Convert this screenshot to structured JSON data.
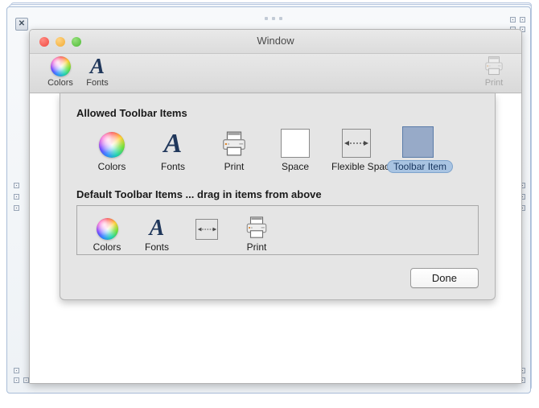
{
  "outer": {
    "close_handle_icon": "close-icon",
    "close_handle_glyph": "✕"
  },
  "window": {
    "title": "Window",
    "traffic_lights": [
      {
        "name": "close",
        "color": "#f24840"
      },
      {
        "name": "minimize",
        "color": "#f2ab33"
      },
      {
        "name": "zoom",
        "color": "#4dbb34"
      }
    ],
    "toolbar": {
      "items": [
        {
          "label": "Colors",
          "icon": "color-wheel-icon",
          "disabled": false
        },
        {
          "label": "Fonts",
          "icon": "font-a-icon",
          "disabled": false
        }
      ],
      "trailing_items": [
        {
          "label": "Print",
          "icon": "printer-icon",
          "disabled": true
        }
      ]
    }
  },
  "sheet": {
    "allowed": {
      "heading": "Allowed Toolbar Items",
      "items": [
        {
          "label": "Colors",
          "icon": "color-wheel-icon",
          "selected": false
        },
        {
          "label": "Fonts",
          "icon": "font-a-icon",
          "selected": false
        },
        {
          "label": "Print",
          "icon": "printer-icon",
          "selected": false
        },
        {
          "label": "Space",
          "icon": "space-box-icon",
          "selected": false
        },
        {
          "label": "Flexible Space",
          "icon": "flexible-space-icon",
          "selected": false
        },
        {
          "label": "Toolbar Item",
          "icon": "toolbar-item-icon",
          "selected": true
        }
      ]
    },
    "defaults": {
      "heading": "Default Toolbar Items ... drag in items from above",
      "items": [
        {
          "label": "Colors",
          "icon": "color-wheel-icon"
        },
        {
          "label": "Fonts",
          "icon": "font-a-icon"
        },
        {
          "label": "",
          "icon": "flexible-space-icon"
        },
        {
          "label": "Print",
          "icon": "printer-icon"
        }
      ]
    },
    "done_label": "Done"
  },
  "colors": {
    "selection_fill": "#a9c4e2",
    "selection_border": "#7ea3cc",
    "selection_text": "#17355e",
    "toolbar_item_fill": "#97aac8",
    "toolbar_item_border": "#5a7ba8",
    "sheet_background": "#e5e5e5",
    "frame_border": "#a9bdd8"
  }
}
